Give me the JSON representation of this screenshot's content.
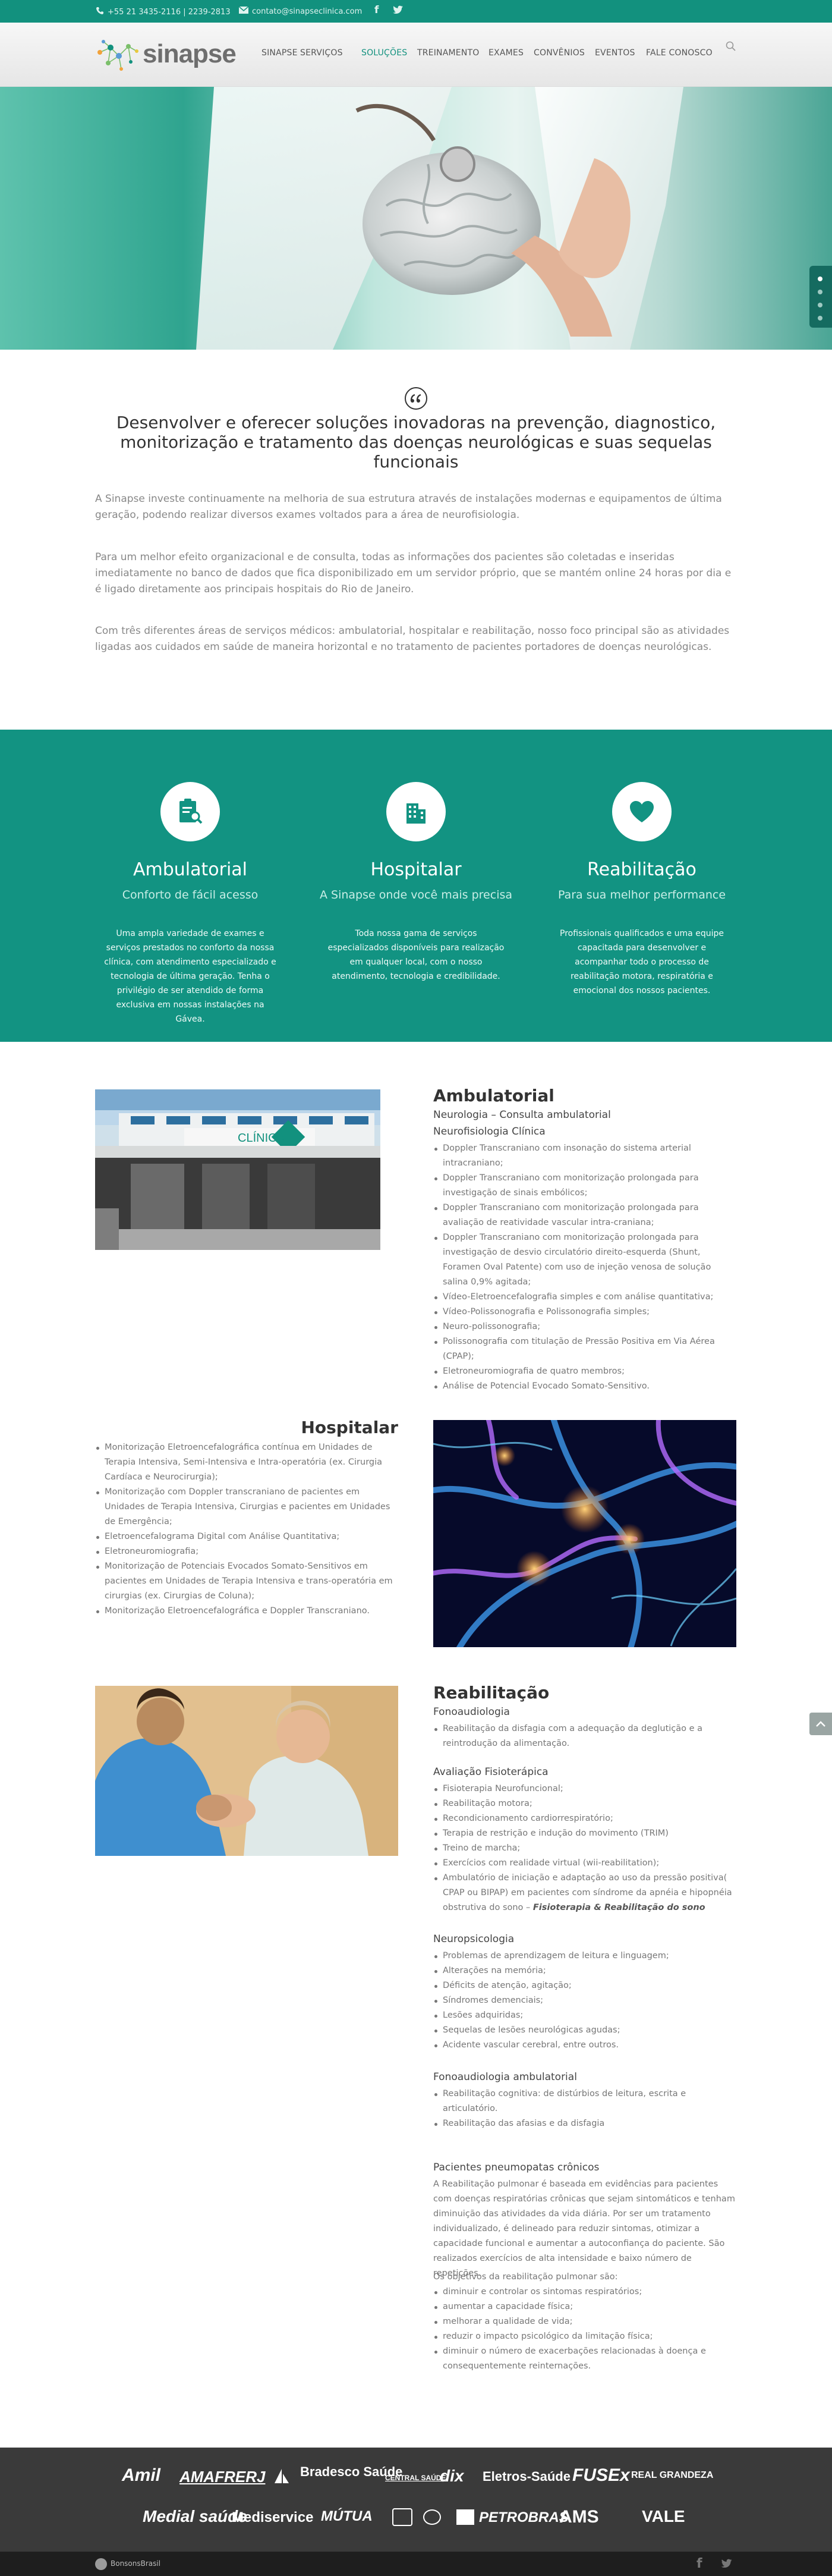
{
  "topbar": {
    "phone": "+55 21 3435-2116 | 2239-2813",
    "email": "contato@sinapseclinica.com"
  },
  "header": {
    "logo_text": "sinapse",
    "nav": [
      "SINAPSE",
      "SERVIÇOS",
      "SOLUÇÕES",
      "TREINAMENTO",
      "EXAMES",
      "CONVÊNIOS",
      "EVENTOS",
      "FALE CONOSCO"
    ],
    "active_nav": "SOLUÇÕES"
  },
  "intro": {
    "heading": "Desenvolver e oferecer soluções inovadoras na prevenção, diagnostico, monitorização e tratamento das doenças neurológicas e suas sequelas funcionais",
    "p1": "A Sinapse investe continuamente na melhoria de sua estrutura através de instalações modernas e equipamentos de última geração, podendo realizar diversos exames voltados para a área de neurofisiologia.",
    "p2": "Para um melhor efeito organizacional e de consulta, todas as informações dos pacientes são coletadas e inseridas imediatamente no banco de dados que fica disponibilizado em um servidor próprio, que se mantém online 24 horas por dia e é ligado diretamente aos principais hospitais do Rio de Janeiro.",
    "p3": "Com três diferentes áreas de serviços médicos: ambulatorial, hospitalar e reabilitação, nosso foco principal são as atividades ligadas aos cuidados em saúde de maneira horizontal e no tratamento de pacientes portadores de doenças neurológicas."
  },
  "services": [
    {
      "title": "Ambulatorial",
      "subtitle": "Conforto de fácil acesso",
      "text": "Uma ampla variedade de exames e serviços prestados no conforto da nossa clínica, com atendimento especializado e tecnologia de última geração. Tenha o privilégio de ser atendido de forma exclusiva em nossas instalações na Gávea."
    },
    {
      "title": "Hospitalar",
      "subtitle": "A Sinapse onde você mais precisa",
      "text": "Toda nossa gama de serviços especializados disponíveis para realização em qualquer local, com o nosso atendimento, tecnologia e credibilidade."
    },
    {
      "title": "Reabilitação",
      "subtitle": "Para sua melhor performance",
      "text": "Profissionais qualificados e uma equipe capacitada para desenvolver e acompanhar todo o processo de reabilitação motora, respiratória e emocional dos nossos pacientes."
    }
  ],
  "ambulatorial": {
    "title": "Ambulatorial",
    "sub1": "Neurologia – Consulta ambulatorial",
    "sub2": "Neurofisiologia Clínica",
    "items": [
      "Doppler Transcraniano com insonação do sistema arterial intracraniano;",
      "Doppler Transcraniano com monitorização prolongada para investigação de sinais embólicos;",
      "Doppler Transcraniano com monitorização prolongada para avaliação de reatividade vascular intra-craniana;",
      "Doppler Transcraniano com monitorização prolongada para investigação de desvio circulatório direito-esquerda (Shunt, Foramen Oval Patente) com uso de injeção venosa de solução salina 0,9% agitada;",
      "Vídeo-Eletroencefalografia simples e com análise quantitativa;",
      "Vídeo-Polissonografia e Polissonografia simples;",
      "Neuro-polissonografia;",
      "Polissonografia com titulação de Pressão Positiva em Via Aérea (CPAP);",
      "Eletroneuromiografia de quatro membros;",
      "Análise de Potencial Evocado Somato-Sensitivo."
    ],
    "clinic_sign": "CLÍNICA"
  },
  "hospitalar": {
    "title": "Hospitalar",
    "items": [
      "Monitorização Eletroencefalográfica contínua em Unidades de Terapia Intensiva, Semi-Intensiva e Intra-operatória (ex. Cirurgia Cardíaca e Neurocirurgia);",
      "Monitorização com Doppler transcraniano de pacientes em Unidades de Terapia Intensiva, Cirurgias e pacientes em Unidades de Emergência;",
      "Eletroencefalograma Digital com Análise Quantitativa;",
      "Eletroneuromiografia;",
      "Monitorização de Potenciais Evocados Somato-Sensitivos em pacientes em Unidades de Terapia Intensiva e trans-operatória em cirurgias (ex. Cirurgias de Coluna);",
      "Monitorização Eletroencefalográfica e Doppler Transcraniano."
    ]
  },
  "reabilitacao": {
    "title": "Reabilitação",
    "fono_title": "Fonoaudiologia",
    "fono_items": [
      "Reabilitação da disfagia com a adequação da deglutição e a reintrodução da alimentação."
    ],
    "fisio_title": "Avaliação Fisioterápica",
    "fisio_items": [
      "Fisioterapia Neurofuncional;",
      "Reabilitação motora;",
      "Recondicionamento cardiorrespiratório;",
      "Terapia de restrição e indução do movimento (TRIM)",
      "Treino de marcha;",
      "Exercícios com realidade virtual (wii-reabilitation);",
      "Ambulatório de iniciação e adaptação ao uso da pressão positiva( CPAP ou BIPAP) em pacientes com síndrome da apnéia e hipopnéia obstrutiva do sono – "
    ],
    "fisio_bold": "Fisioterapia & Reabilitação do sono",
    "neuro_title": "Neuropsicologia",
    "neuro_items": [
      "Problemas de aprendizagem de leitura e linguagem;",
      "Alterações na memória;",
      "Déficits de atenção, agitação;",
      "Síndromes demenciais;",
      "Lesões adquiridas;",
      "Sequelas de lesões neurológicas agudas;",
      "Acidente vascular cerebral, entre outros."
    ],
    "fonoamb_title": "Fonoaudiologia ambulatorial",
    "fonoamb_items": [
      "Reabilitação cognitiva: de distúrbios de leitura, escrita e articulatório.",
      "Reabilitação das afasias e da disfagia"
    ],
    "pneumo_title": "Pacientes pneumopatas crônicos",
    "pneumo_text": "A Reabilitação pulmonar é baseada em evidências para pacientes com doenças respiratórias crônicas que sejam sintomáticos e tenham diminuição das atividades da vida diária. Por ser um tratamento individualizado, é delineado para reduzir sintomas, otimizar a capacidade funcional e aumentar a autoconfiança do paciente. São realizados exercícios de alta intensidade e baixo número de repetições.",
    "obj_title": "Os objetivos da reabilitação pulmonar são:",
    "obj_items": [
      "diminuir e controlar os sintomas respiratórios;",
      "aumentar a capacidade física;",
      "melhorar a qualidade de vida;",
      "reduzir o impacto psicológico da limitação física;",
      "diminuir o número de exacerbações relacionadas à doença e consequentemente reinternações."
    ]
  },
  "partners_row1": [
    "Amil",
    "AMAFRERJ",
    "",
    "Bradesco Saúde",
    "CENTRAL SAÚDE",
    "dix",
    "Eletros-Saúde",
    "FUSEx",
    "REAL GRANDEZA"
  ],
  "partners_row2": [
    "Medial saúde",
    "Mediservice",
    "MÚTUA",
    "",
    "",
    "",
    "PETROBRAS",
    "AMS",
    "VALE"
  ],
  "footer": {
    "brand": "BonsonsBrasil"
  }
}
